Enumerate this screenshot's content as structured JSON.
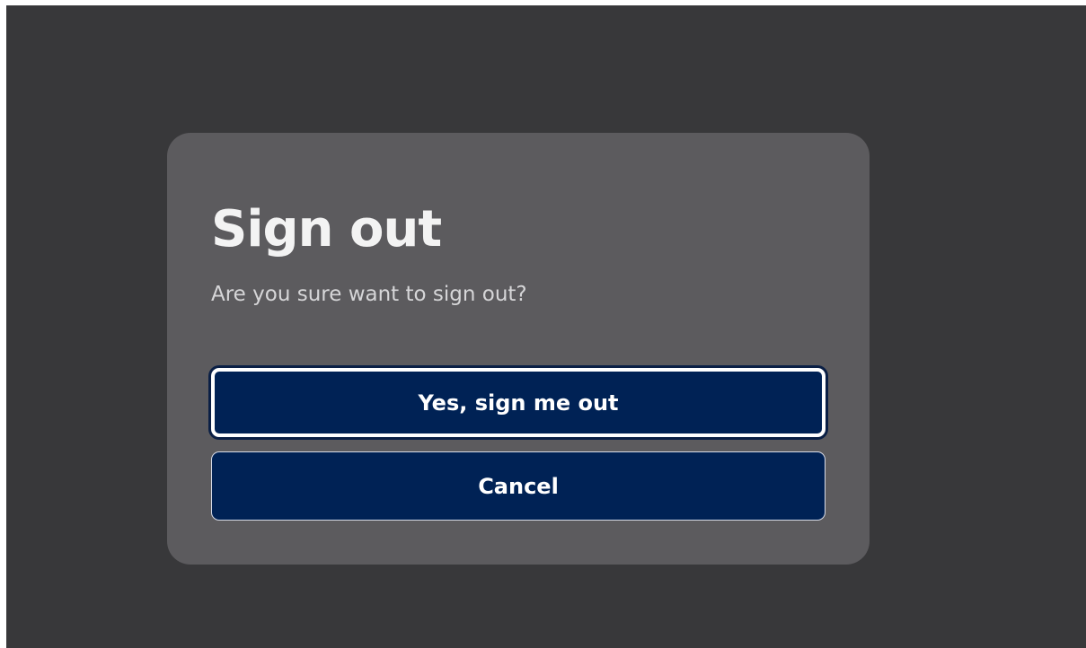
{
  "dialog": {
    "title": "Sign out",
    "message": "Are you sure want to sign out?",
    "confirm_label": "Yes, sign me out",
    "cancel_label": "Cancel"
  },
  "colors": {
    "backdrop": "#38383a",
    "dialog_background": "#5c5b5e",
    "button_background": "#002255",
    "button_text": "#ffffff",
    "focus_ring": "#ffffff"
  },
  "state": {
    "focused_button": "confirm"
  }
}
